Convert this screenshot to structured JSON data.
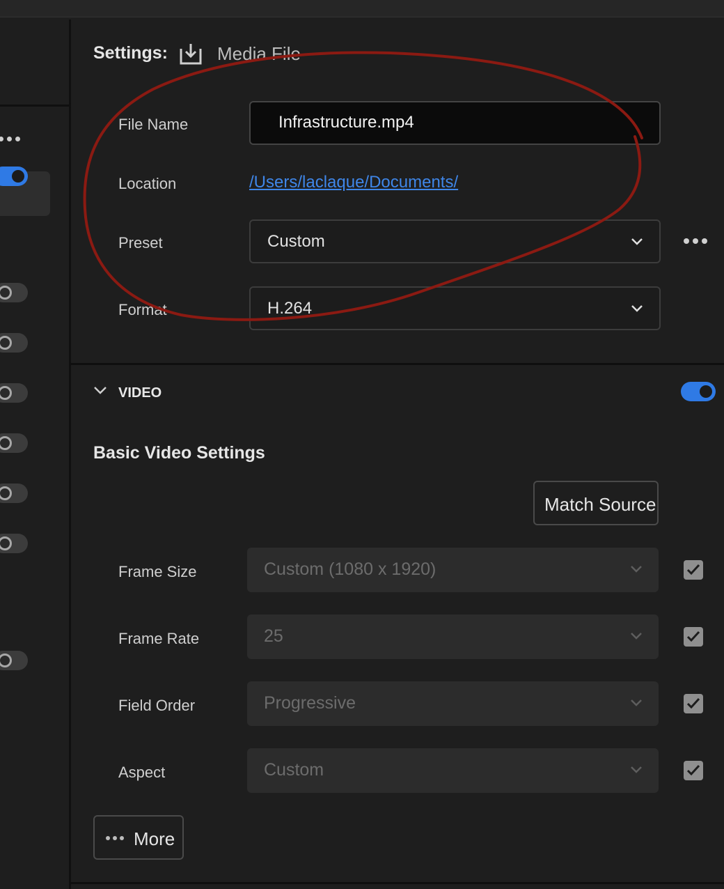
{
  "settings": {
    "title": "Settings:",
    "destination": "Media File",
    "file_name_label": "File Name",
    "file_name_value": "Infrastructure.mp4",
    "location_label": "Location",
    "location_value": "/Users/laclaque/Documents/",
    "preset_label": "Preset",
    "preset_value": "Custom",
    "format_label": "Format",
    "format_value": "H.264"
  },
  "video": {
    "section_label": "VIDEO",
    "enabled": true,
    "basic_title": "Basic Video Settings",
    "match_source_label": "Match Source",
    "rows": [
      {
        "label": "Frame Size",
        "value": "Custom (1080 x 1920)",
        "checked": true
      },
      {
        "label": "Frame Rate",
        "value": "25",
        "checked": true
      },
      {
        "label": "Field Order",
        "value": "Progressive",
        "checked": true
      },
      {
        "label": "Aspect",
        "value": "Custom",
        "checked": true
      }
    ],
    "more_label": "More"
  },
  "sidebar": {
    "toggles": [
      true,
      false,
      false,
      false,
      false,
      false,
      false,
      false
    ]
  },
  "colors": {
    "accent": "#2f7ae5",
    "link": "#3f86e8",
    "annotation": "#8b1a12",
    "background": "#1e1e1e"
  }
}
